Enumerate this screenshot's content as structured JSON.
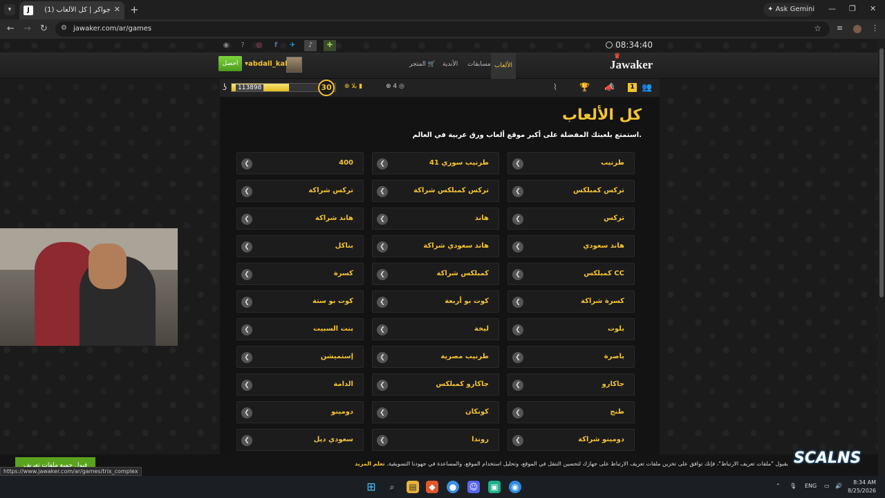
{
  "browser": {
    "tab_title": "(1) جواكر | كل الألعاب",
    "tab_icon_letter": "J",
    "new_tab_symbol": "+",
    "ask_gemini": "Ask Gemini",
    "url": "jawaker.com/ar/games",
    "status_url": "https://www.jawaker.com/ar/games/trix_complex"
  },
  "site": {
    "logo": "Jawaker",
    "clock": "08:34:40",
    "nav": {
      "games": "الألعاب",
      "contests": "مسابقات",
      "clubs": "الأندية",
      "store": "المتجر"
    },
    "user": {
      "name": "abdall_kal",
      "get_button": "احصل"
    },
    "status": {
      "coins": "113898",
      "level": "30",
      "xp_progress": 0.55,
      "tokens_label": "بلا",
      "gifts_count": "4",
      "notification_badge": "1"
    }
  },
  "main": {
    "title": "كل الألعاب",
    "subtitle": "استمتع بلعبتك المفضلة على أكبر موقع ألعاب ورق عربية في العالم.",
    "games": [
      [
        "طرنيب",
        "طرنيب سوري 41",
        "400"
      ],
      [
        "تركس كمبلكس",
        "تركس كمبلكس شراكة",
        "تركس شراكة"
      ],
      [
        "تركس",
        "هاند",
        "هاند شراكة"
      ],
      [
        "هاند سعودي",
        "هاند سعودي شراكة",
        "بناكل"
      ],
      [
        "كمبلكس CC",
        "كمبلكس شراكة",
        "كسرة"
      ],
      [
        "كسرة شراكة",
        "كوت بو أربعة",
        "كوت بو ستة"
      ],
      [
        "بلوت",
        "ليخة",
        "بنت السبيت"
      ],
      [
        "باصرة",
        "طرنيب مصرية",
        "إستميشن"
      ],
      [
        "جاكارو",
        "جاكارو كمبلكس",
        "الدامة"
      ],
      [
        "طنج",
        "كونكان",
        "دومينو"
      ],
      [
        "دومينو شراكة",
        "روندا",
        "سعودي ديل"
      ]
    ]
  },
  "cookie": {
    "text": "بقبول \"ملفات تعريف الارتباط\"، فإنك توافق على تخزين ملفات تعريف الارتباط على جهازك لتحسين التنقل في الموقع، وتحليل استخدام الموقع، والمساعدة في جهودنا التسويقية.",
    "learn_more": "تعلم المزيد",
    "accept_button": "قبول جميع ملفات تعريف الارتباط"
  },
  "overlay": {
    "watermark": "SCALNS"
  },
  "taskbar": {
    "language": "ENG",
    "time": "8:34 AM",
    "date": "8/25/2026"
  }
}
